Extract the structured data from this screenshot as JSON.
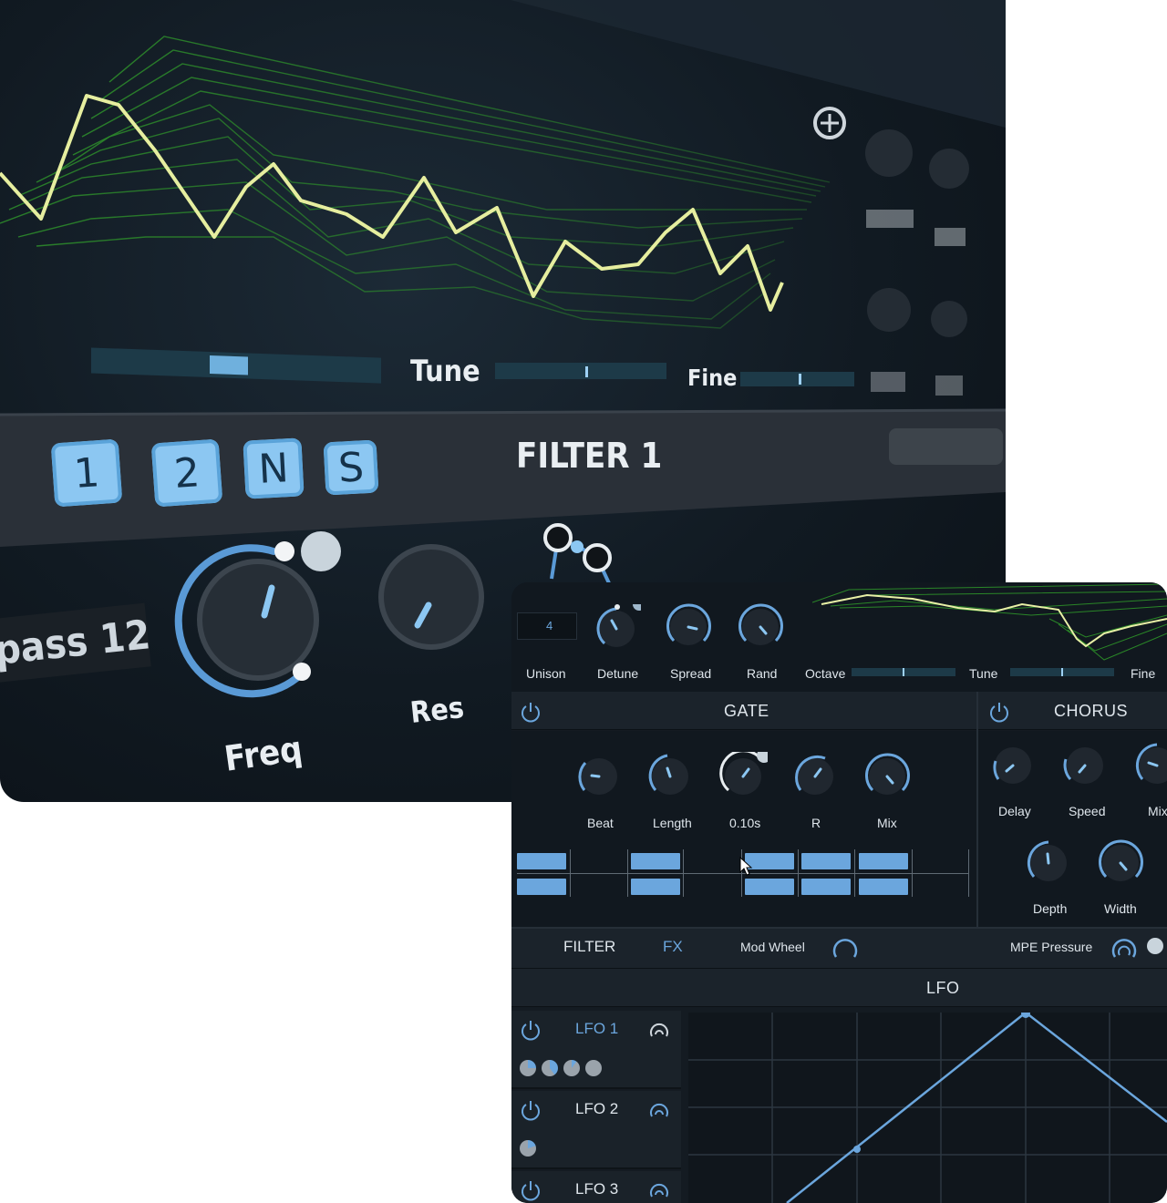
{
  "hero": {
    "tune_label": "Tune",
    "fine_label": "Fine",
    "filter_title": "FILTER 1",
    "freq_label": "Freq",
    "res_label": "Res",
    "mode_text": "pass 12",
    "pad_buttons": [
      "1",
      "2",
      "N",
      "S"
    ]
  },
  "osc": {
    "unison_value": "4",
    "labels": {
      "unison": "Unison",
      "detune": "Detune",
      "spread": "Spread",
      "rand": "Rand",
      "octave": "Octave",
      "tune": "Tune",
      "fine": "Fine"
    }
  },
  "gate": {
    "title": "GATE",
    "knobs": [
      "Beat",
      "Length",
      "0.10s",
      "R",
      "Mix"
    ]
  },
  "chorus": {
    "title": "CHORUS",
    "knobs_row1": [
      "Delay",
      "Speed",
      "Mix"
    ],
    "knobs_row2": [
      "Depth",
      "Width"
    ]
  },
  "mod_bar": {
    "filter_tab": "FILTER",
    "fx_tab": "FX",
    "mod_wheel": "Mod Wheel",
    "mpe_pressure": "MPE Pressure"
  },
  "lfo": {
    "title": "LFO",
    "items": [
      "LFO 1",
      "LFO 2",
      "LFO 3"
    ]
  },
  "colors": {
    "accent": "#6ba6dd",
    "wave_green": "#3fae2e",
    "wave_highlight": "#e8f0a6",
    "panel_bg": "#141b22"
  }
}
